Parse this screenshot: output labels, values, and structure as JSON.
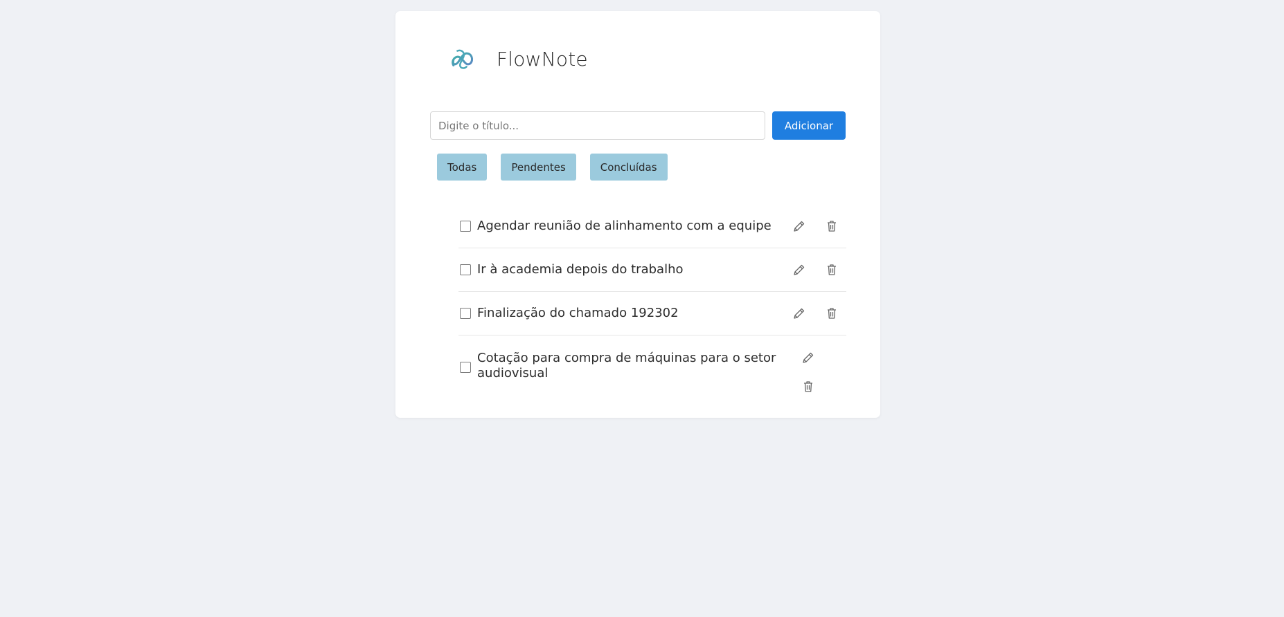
{
  "app": {
    "title": "FlowNote"
  },
  "add_form": {
    "placeholder": "Digite o título...",
    "value": "",
    "button_label": "Adicionar"
  },
  "filters": [
    {
      "label": "Todas"
    },
    {
      "label": "Pendentes"
    },
    {
      "label": "Concluídas"
    }
  ],
  "tasks": [
    {
      "text": "Agendar reunião de alinhamento com a equipe",
      "done": false
    },
    {
      "text": "Ir à academia depois do trabalho",
      "done": false
    },
    {
      "text": "Finalização do chamado 192302",
      "done": false
    },
    {
      "text": "Cotação para compra de máquinas para o setor audiovisual",
      "done": false
    }
  ],
  "icons": {
    "logo": "infinity-logo-icon",
    "edit": "pencil-icon",
    "delete": "trash-icon"
  },
  "colors": {
    "background": "#eff1f5",
    "primary_button": "#1f7ee0",
    "filter_button": "#9bcadd",
    "logo_teal": "#3fb4a8",
    "logo_blue": "#5b86c5"
  }
}
